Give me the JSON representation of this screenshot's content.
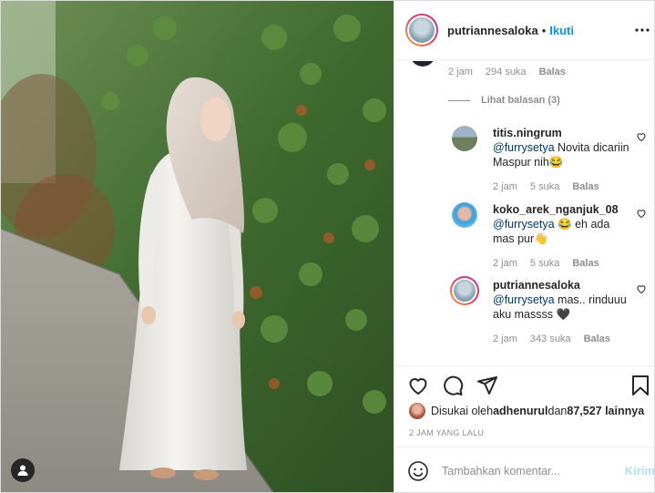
{
  "post_header": {
    "username": "putriannesaloka",
    "separator": "•",
    "follow_label": "Ikuti",
    "more_icon": "more-horizontal-icon"
  },
  "parent_comment_meta": {
    "time": "2 jam",
    "likes": "294 suka",
    "reply_label": "Balas"
  },
  "view_replies_label": "Lihat balasan (3)",
  "replies": [
    {
      "username": "titis.ningrum",
      "mention": "@furrysetya",
      "text": " Novita dicariin Maspur nih😂",
      "time": "2 jam",
      "likes": "5 suka",
      "reply_label": "Balas"
    },
    {
      "username": "koko_arek_nganjuk_08",
      "mention": "@furrysetya",
      "text": " 😂 eh ada mas pur👋",
      "time": "2 jam",
      "likes": "5 suka",
      "reply_label": "Balas"
    },
    {
      "username": "putriannesaloka",
      "mention": "@furrysetya",
      "text": " mas.. rinduuu aku massss 🖤",
      "time": "2 jam",
      "likes": "343 suka",
      "reply_label": "Balas"
    }
  ],
  "actions": {
    "like_icon": "heart-icon",
    "comment_icon": "comment-icon",
    "share_icon": "share-icon",
    "save_icon": "bookmark-icon"
  },
  "likes_summary": {
    "prefix": "Disukai oleh ",
    "user": "adhenurul",
    "middle": " dan ",
    "count": "87,527 lainnya"
  },
  "post_time": "2 JAM YANG LALU",
  "add_comment": {
    "placeholder": "Tambahkan komentar...",
    "post_label": "Kirim"
  },
  "colors": {
    "accent": "#0095f6",
    "post_disabled": "#b2dffc",
    "muted": "#8e8e8e"
  }
}
